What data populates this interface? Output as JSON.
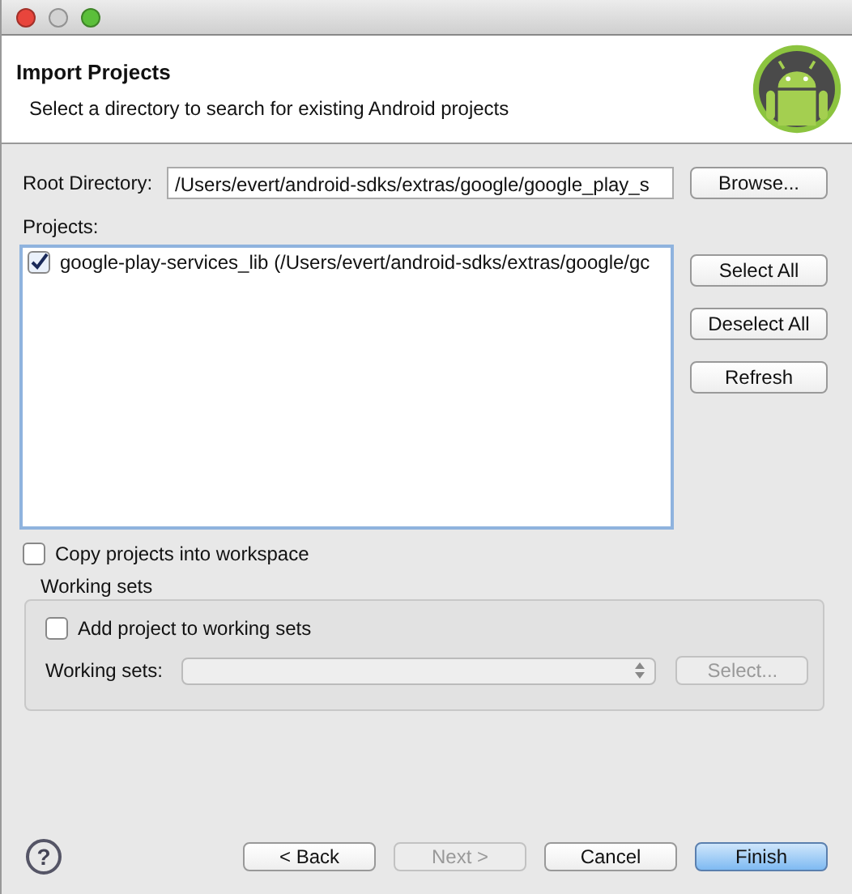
{
  "window": {
    "controls": [
      {
        "color": "#e8453c"
      },
      {
        "color": "#d2d2d2"
      },
      {
        "color": "#5bbf3a"
      }
    ]
  },
  "header": {
    "title": "Import Projects",
    "description": "Select a directory to search for existing Android projects"
  },
  "root_directory": {
    "label": "Root Directory:",
    "value": "/Users/evert/android-sdks/extras/google/google_play_s",
    "button": "Browse..."
  },
  "projects": {
    "label": "Projects:",
    "items": [
      {
        "label": "google-play-services_lib (/Users/evert/android-sdks/extras/google/gc",
        "checked": true
      }
    ],
    "buttons": [
      {
        "label": "Select All",
        "disabled": false
      },
      {
        "label": "Deselect All",
        "disabled": false
      },
      {
        "label": "Refresh",
        "disabled": false
      }
    ]
  },
  "copy_into_workspace": {
    "label": "Copy projects into workspace",
    "checked": false
  },
  "working_sets": {
    "title": "Working sets",
    "add": {
      "label": "Add project to working sets",
      "checked": false
    },
    "select_label": "Working sets:",
    "select_disabled": true,
    "select_button": {
      "label": "Select...",
      "disabled": true
    }
  },
  "footer": {
    "help": "?",
    "buttons": [
      {
        "label": "< Back",
        "disabled": false,
        "default": false
      },
      {
        "label": "Next >",
        "disabled": true,
        "default": false
      },
      {
        "label": "Cancel",
        "disabled": false,
        "default": false
      },
      {
        "label": "Finish",
        "disabled": false,
        "default": true
      }
    ]
  }
}
